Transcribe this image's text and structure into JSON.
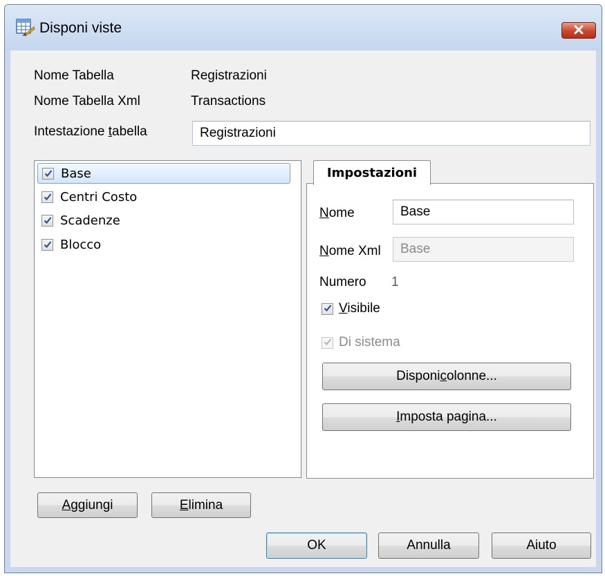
{
  "window": {
    "title": "Disponi viste"
  },
  "info": {
    "table_name_label": "Nome Tabella",
    "table_name_value": "Registrazioni",
    "xml_name_label": "Nome Tabella Xml",
    "xml_name_value": "Transactions",
    "header_label_pre": "Intestazione ",
    "header_label_key": "t",
    "header_label_post": "abella",
    "header_value": "Registrazioni"
  },
  "views": [
    {
      "label": "Base",
      "checked": true,
      "selected": true
    },
    {
      "label": "Centri Costo",
      "checked": true,
      "selected": false
    },
    {
      "label": "Scadenze",
      "checked": true,
      "selected": false
    },
    {
      "label": "Blocco",
      "checked": true,
      "selected": false
    }
  ],
  "settings": {
    "tab_label": "Impostazioni",
    "name_label_key": "N",
    "name_label_post": "ome",
    "name_value": "Base",
    "xml_label_key": "N",
    "xml_label_post": "ome Xml",
    "xml_value": "Base",
    "number_label": "Numero",
    "number_value": "1",
    "visible_label_key": "V",
    "visible_label_post": "isibile",
    "visible_checked": true,
    "system_label": "Di sistema",
    "system_checked": true,
    "columns_btn_pre": "Disponi ",
    "columns_btn_key": "c",
    "columns_btn_post": "olonne...",
    "page_btn_key": "I",
    "page_btn_post": "mposta pagina..."
  },
  "buttons": {
    "add_key": "A",
    "add_post": "ggiungi",
    "delete_key": "E",
    "delete_post": "limina",
    "ok": "OK",
    "cancel": "Annulla",
    "help": "Aiuto"
  },
  "colors": {
    "selection_border": "#7da2ce",
    "check_mark": "#2a4f9c",
    "close_button": "#c8482c"
  },
  "icons": {
    "app": "layout-view-icon",
    "close": "close-icon",
    "check": "check-mark-icon"
  }
}
